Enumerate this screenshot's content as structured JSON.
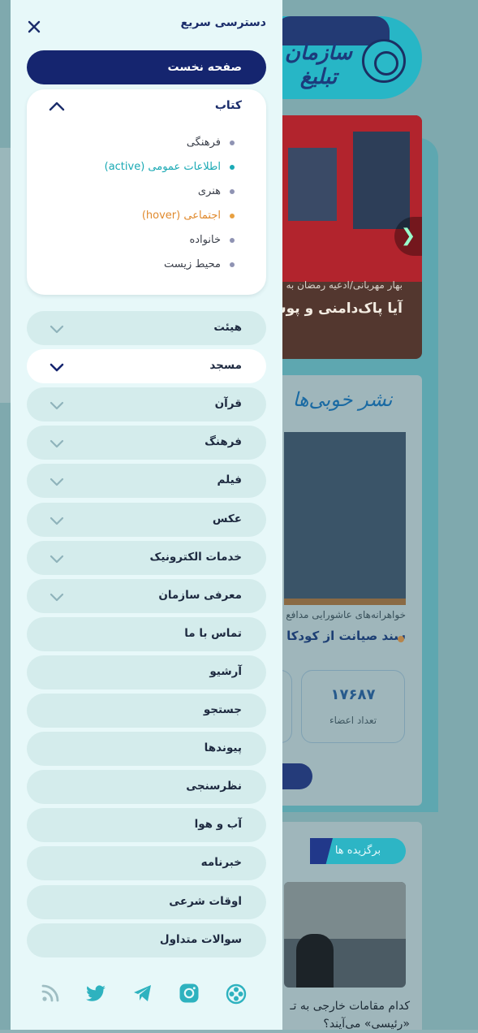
{
  "background_page": {
    "logo_text": "سازمان تبلیغ",
    "slider": {
      "subtitle": "بهار مهربانی/ادعیه رمضان به",
      "title": "آیا پاک‌دامنی و پوشش"
    },
    "news_card": {
      "brand": "نشر خوبی‌ها",
      "subtitle": "خواهرانه‌های عاشورایی مدافع",
      "title": "سند صیانت از کودکان"
    },
    "stat": {
      "value": "۱۷۶۸۷",
      "label": "تعداد اعضاء"
    },
    "badge": "برگزیده ها",
    "news_title": "کدام مقامات خارجی به تـ «رئیسی» می‌آیند؟"
  },
  "drawer": {
    "title": "دسترسی سریع",
    "home": "صفحه نخست",
    "book": {
      "label": "کتاب",
      "items": [
        {
          "label": "فرهنگی",
          "state": "normal"
        },
        {
          "label": "اطلاعات عمومی (active)",
          "state": "active"
        },
        {
          "label": "هنری",
          "state": "normal"
        },
        {
          "label": "اجتماعی (hover)",
          "state": "hover"
        },
        {
          "label": "خانواده",
          "state": "normal"
        },
        {
          "label": "محیط زیست",
          "state": "normal"
        }
      ]
    },
    "menu": [
      {
        "label": "هیئت",
        "has_children": true
      },
      {
        "label": "مسجد",
        "has_children": true
      },
      {
        "label": "قرآن",
        "has_children": true
      },
      {
        "label": "فرهنگ",
        "has_children": true
      },
      {
        "label": "فیلم",
        "has_children": true
      },
      {
        "label": "عکس",
        "has_children": true
      },
      {
        "label": "خدمات الکترونیک",
        "has_children": true
      },
      {
        "label": "معرفی سازمان",
        "has_children": true
      },
      {
        "label": "تماس با ما",
        "has_children": false
      },
      {
        "label": "آرشیو",
        "has_children": false
      },
      {
        "label": "جستجو",
        "has_children": false
      },
      {
        "label": "پیوندها",
        "has_children": false
      },
      {
        "label": "نظرسنجی",
        "has_children": false
      },
      {
        "label": "آب و هوا",
        "has_children": false
      },
      {
        "label": "خبرنامه",
        "has_children": false
      },
      {
        "label": "اوقات شرعی",
        "has_children": false
      },
      {
        "label": "سوالات متداول",
        "has_children": false
      }
    ],
    "social_icons": [
      "aparat-icon",
      "instagram-icon",
      "telegram-icon",
      "twitter-icon",
      "rss-icon"
    ]
  },
  "colors": {
    "navy": "#15256f",
    "teal_accent": "#1aa9b4",
    "hover_orange": "#e08a2e",
    "drawer_bg": "#e7f8f9",
    "pill_bg": "#d4ecec",
    "social_icon": "#2eb2bf"
  }
}
